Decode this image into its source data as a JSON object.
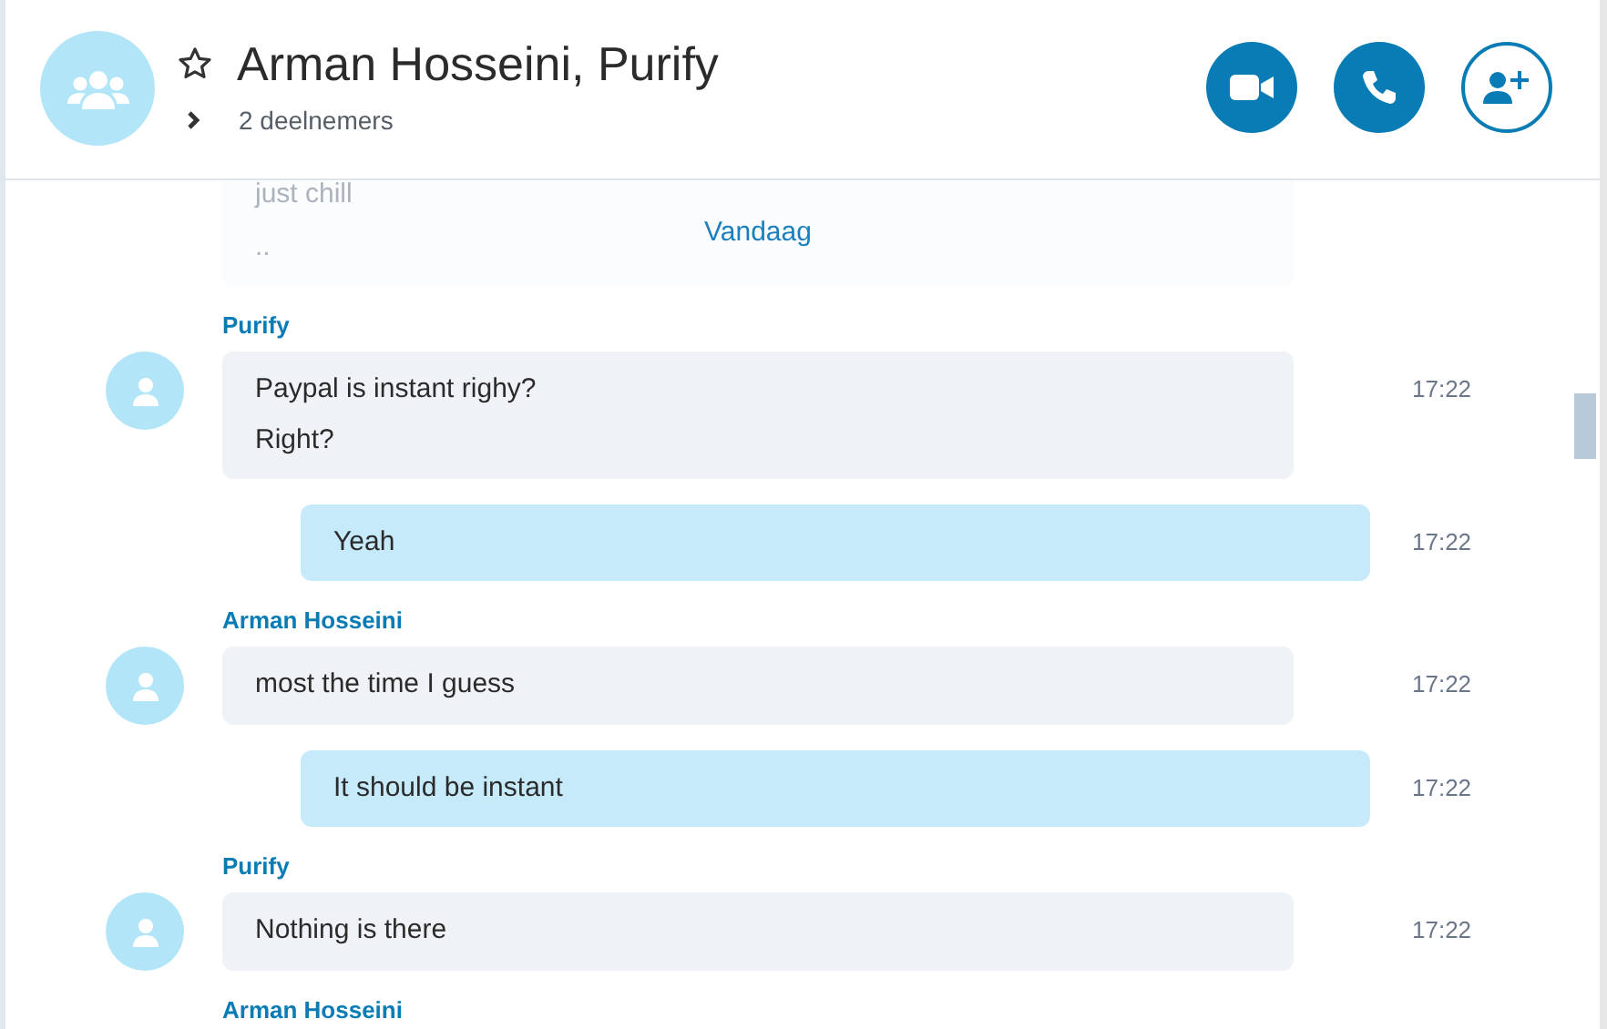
{
  "conversation": {
    "title": "Arman Hosseini, Purify",
    "favorite": false,
    "expanded": false,
    "participants": "2 deelnemers"
  },
  "header_buttons": [
    {
      "kind": "video"
    },
    {
      "kind": "call"
    },
    {
      "kind": "add-person"
    }
  ],
  "faded_message": {
    "lines": [
      "just chill",
      ".."
    ]
  },
  "date_divider": "Vandaag",
  "messages": [
    {
      "kind": "incoming",
      "sender": "Purify",
      "lines": [
        "Paypal is instant righy?",
        "Right?"
      ],
      "time": "17:22"
    },
    {
      "kind": "outgoing",
      "lines": [
        "Yeah"
      ],
      "time": "17:22"
    },
    {
      "kind": "incoming",
      "sender": "Arman Hosseini",
      "lines": [
        "most the time I guess"
      ],
      "time": "17:22"
    },
    {
      "kind": "outgoing",
      "lines": [
        "It should be instant"
      ],
      "time": "17:22"
    },
    {
      "kind": "incoming",
      "sender": "Purify",
      "lines": [
        "Nothing is there"
      ],
      "time": "17:22"
    },
    {
      "kind": "incoming",
      "sender": "Arman Hosseini"
    }
  ]
}
